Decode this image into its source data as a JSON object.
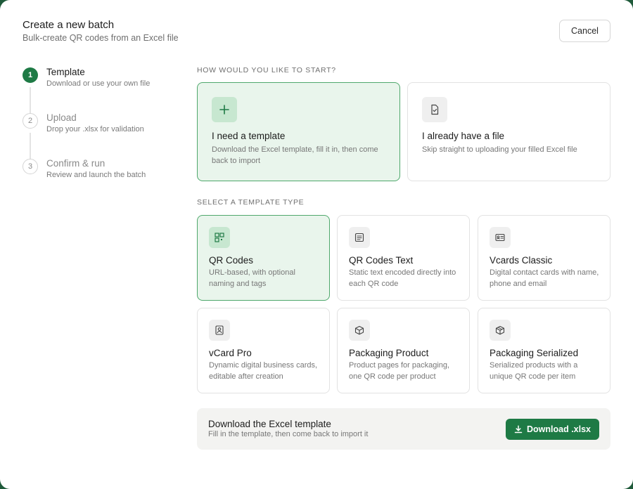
{
  "header": {
    "title": "Create a new batch",
    "subtitle": "Bulk-create QR codes from an Excel file",
    "cancel_label": "Cancel"
  },
  "steps": [
    {
      "number": "1",
      "title": "Template",
      "desc": "Download or use your own file",
      "state": "active"
    },
    {
      "number": "2",
      "title": "Upload",
      "desc": "Drop your .xlsx for validation",
      "state": "inactive"
    },
    {
      "number": "3",
      "title": "Confirm & run",
      "desc": "Review and launch the batch",
      "state": "inactive"
    }
  ],
  "start_section": {
    "label": "HOW WOULD YOU LIKE TO START?",
    "options": [
      {
        "title": "I need a template",
        "desc": "Download the Excel template, fill it in, then come back to import",
        "icon": "plus-icon",
        "selected": true
      },
      {
        "title": "I already have a file",
        "desc": "Skip straight to uploading your filled Excel file",
        "icon": "file-check-icon",
        "selected": false
      }
    ]
  },
  "template_section": {
    "label": "SELECT A TEMPLATE TYPE",
    "types": [
      {
        "title": "QR Codes",
        "desc": "URL-based, with optional naming and tags",
        "icon": "qr-grid-icon",
        "selected": true
      },
      {
        "title": "QR Codes Text",
        "desc": "Static text encoded directly into each QR code",
        "icon": "text-doc-icon",
        "selected": false
      },
      {
        "title": "Vcards Classic",
        "desc": "Digital contact cards with name, phone and email",
        "icon": "id-card-icon",
        "selected": false
      },
      {
        "title": "vCard Pro",
        "desc": "Dynamic digital business cards, editable after creation",
        "icon": "contact-badge-icon",
        "selected": false
      },
      {
        "title": "Packaging Product",
        "desc": "Product pages for packaging, one QR code per product",
        "icon": "box-icon",
        "selected": false
      },
      {
        "title": "Packaging Serialized",
        "desc": "Serialized products with a unique QR code per item",
        "icon": "box-serial-icon",
        "selected": false
      }
    ]
  },
  "download": {
    "title": "Download the Excel template",
    "desc": "Fill in the template, then come back to import it",
    "button_label": "Download .xlsx",
    "button_icon": "download-icon"
  },
  "colors": {
    "accent": "#1e7a45",
    "selected_bg": "#e9f5ec",
    "selected_border": "#4fa86c"
  }
}
